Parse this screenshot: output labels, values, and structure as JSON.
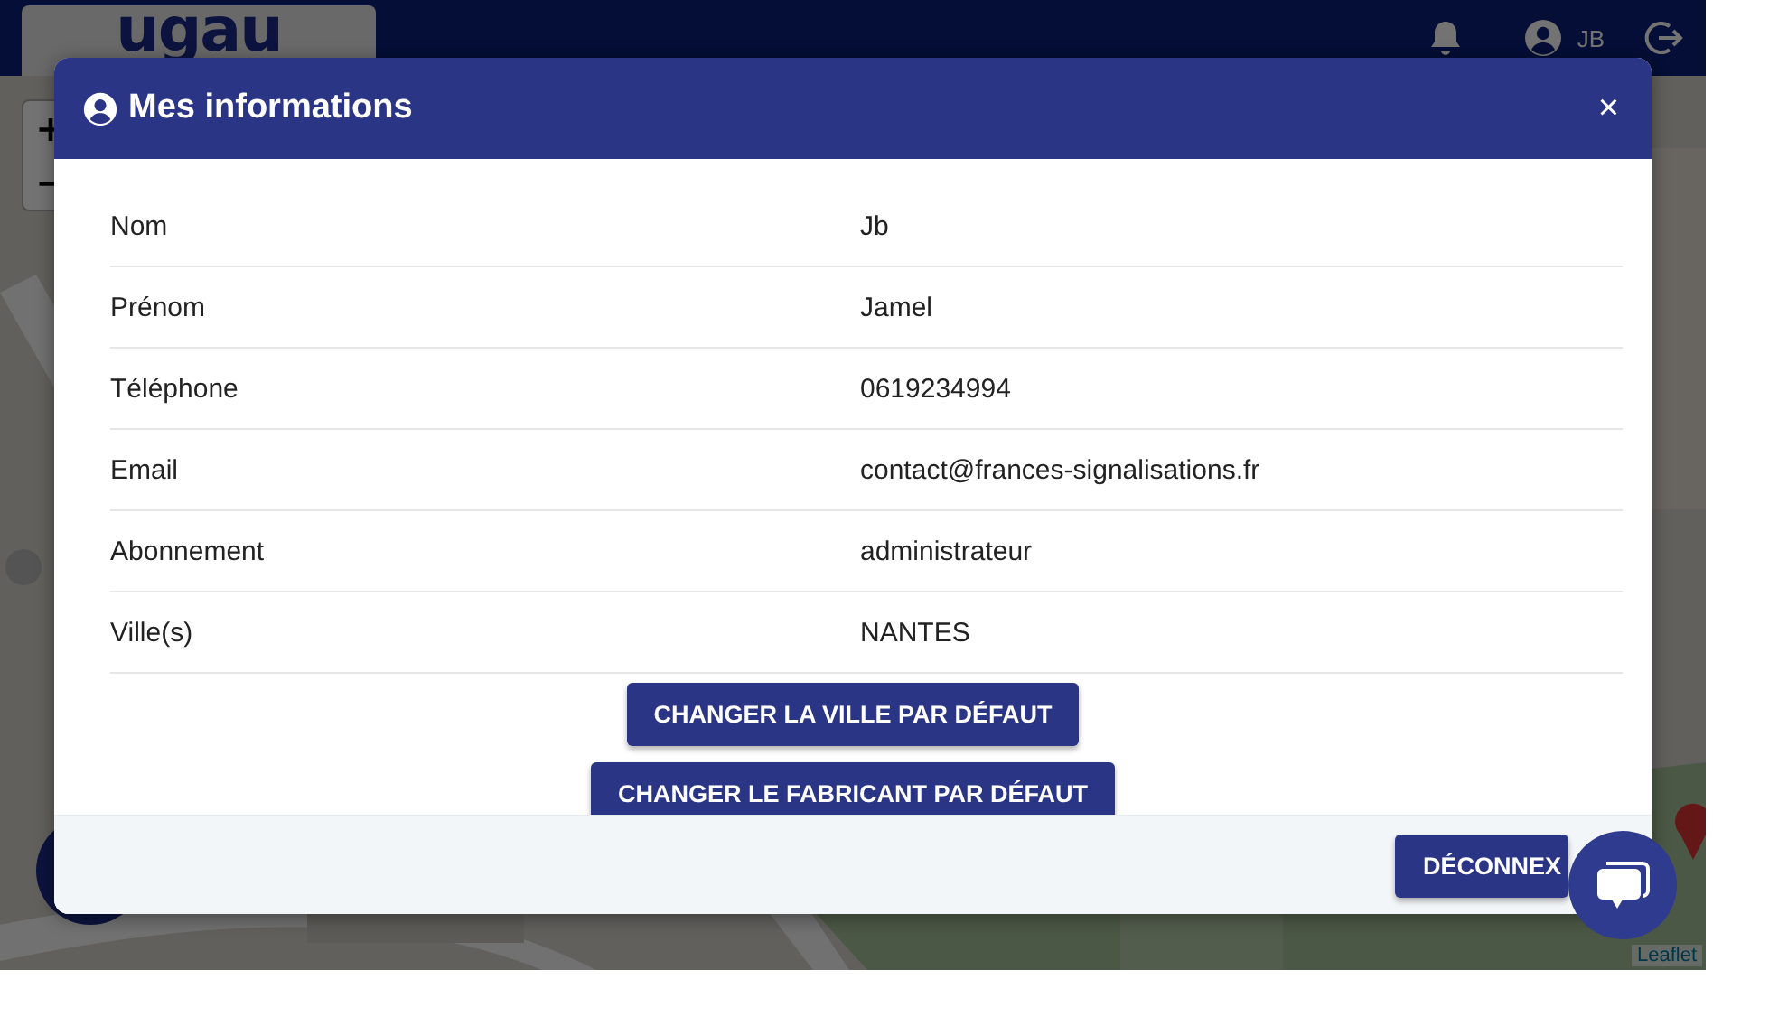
{
  "top_bar": {
    "logo": "ugau",
    "user": "JB"
  },
  "map": {
    "zoom_in": "+",
    "zoom_out": "−",
    "attribution": "Leaflet"
  },
  "modal": {
    "title": "Mes informations",
    "close": "×",
    "rows": [
      {
        "label": "Nom",
        "value": "Jb"
      },
      {
        "label": "Prénom",
        "value": "Jamel"
      },
      {
        "label": "Téléphone",
        "value": "0619234994"
      },
      {
        "label": "Email",
        "value": "contact@frances-signalisations.fr"
      },
      {
        "label": "Abonnement",
        "value": "administrateur"
      },
      {
        "label": "Ville(s)",
        "value": "NANTES"
      }
    ],
    "actions": [
      "CHANGER LA VILLE PAR DÉFAUT",
      "CHANGER LE FABRICANT PAR DÉFAUT"
    ],
    "footer_button": "DÉCONNEX"
  }
}
